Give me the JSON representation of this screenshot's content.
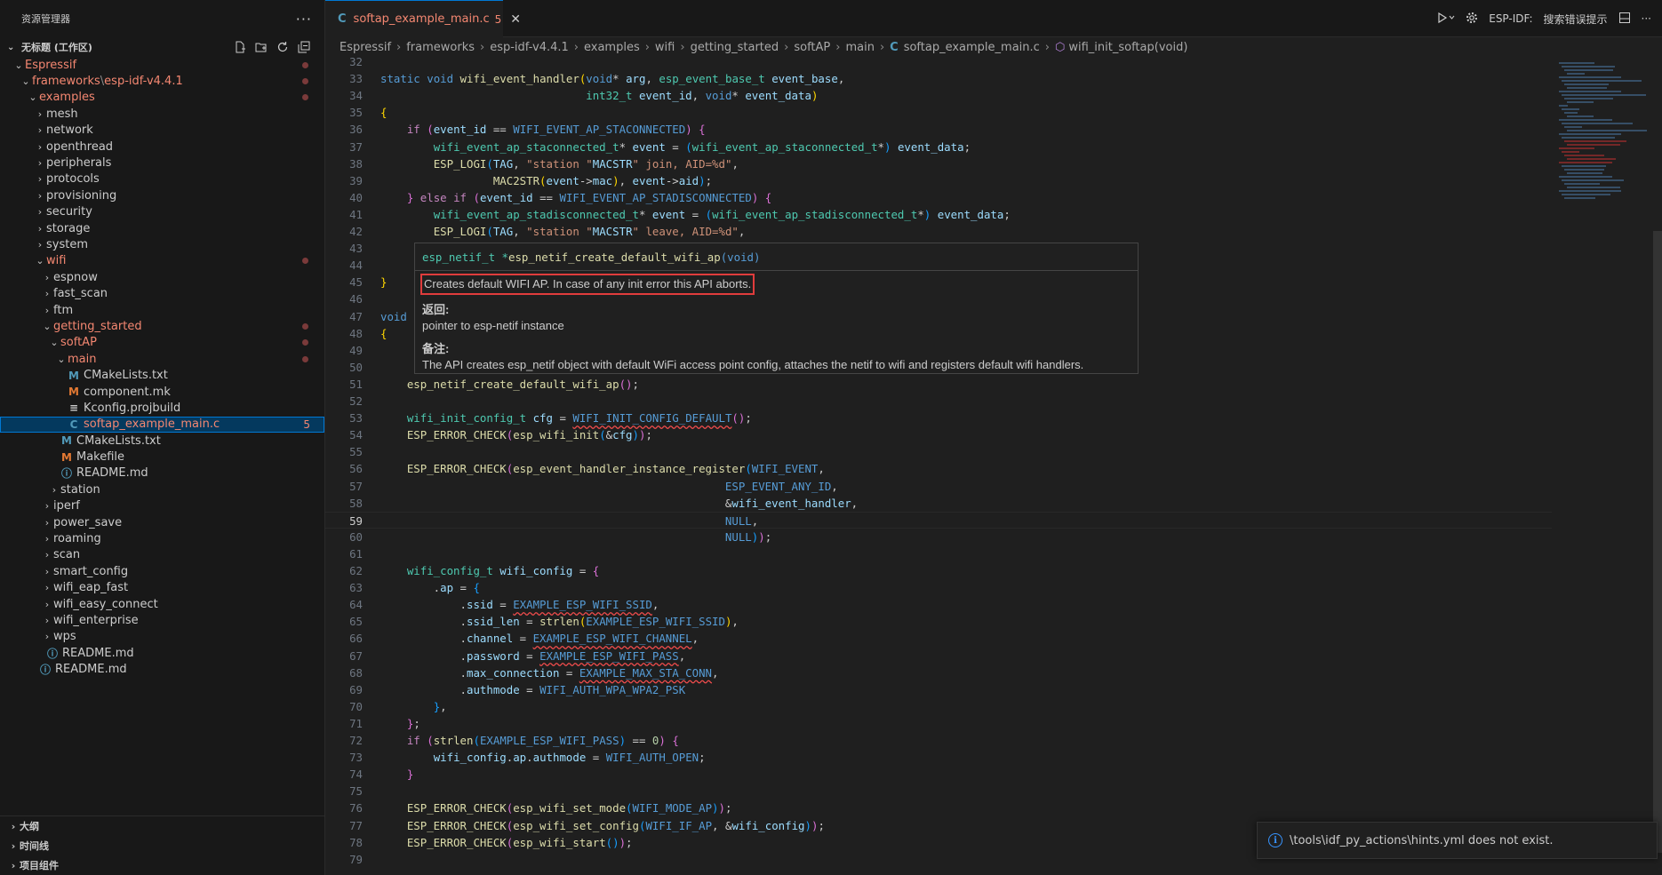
{
  "sidebar": {
    "title": "资源管理器",
    "more": "···",
    "workspace": "无标题 (工作区)",
    "tree": [
      {
        "label": "Espressif",
        "depth": 1,
        "chev": "down",
        "cls": "err",
        "dot": true
      },
      {
        "label": "frameworks",
        "label2": "esp-idf-v4.4.1",
        "depth": 2,
        "chev": "down",
        "cls": "err",
        "dot": true
      },
      {
        "label": "examples",
        "depth": 3,
        "chev": "down",
        "cls": "err",
        "dot": true
      },
      {
        "label": "mesh",
        "depth": 4,
        "chev": "right"
      },
      {
        "label": "network",
        "depth": 4,
        "chev": "right"
      },
      {
        "label": "openthread",
        "depth": 4,
        "chev": "right"
      },
      {
        "label": "peripherals",
        "depth": 4,
        "chev": "right"
      },
      {
        "label": "protocols",
        "depth": 4,
        "chev": "right"
      },
      {
        "label": "provisioning",
        "depth": 4,
        "chev": "right"
      },
      {
        "label": "security",
        "depth": 4,
        "chev": "right"
      },
      {
        "label": "storage",
        "depth": 4,
        "chev": "right"
      },
      {
        "label": "system",
        "depth": 4,
        "chev": "right"
      },
      {
        "label": "wifi",
        "depth": 4,
        "chev": "down",
        "cls": "err",
        "dot": true
      },
      {
        "label": "espnow",
        "depth": 5,
        "chev": "right"
      },
      {
        "label": "fast_scan",
        "depth": 5,
        "chev": "right"
      },
      {
        "label": "ftm",
        "depth": 5,
        "chev": "right"
      },
      {
        "label": "getting_started",
        "depth": 5,
        "chev": "down",
        "cls": "err",
        "dot": true
      },
      {
        "label": "softAP",
        "depth": 6,
        "chev": "down",
        "cls": "err",
        "dot": true
      },
      {
        "label": "main",
        "depth": 7,
        "chev": "down",
        "cls": "err",
        "dot": true
      },
      {
        "label": "CMakeLists.txt",
        "depth": 8,
        "icon": "M",
        "iconColor": "#519aba"
      },
      {
        "label": "component.mk",
        "depth": 8,
        "icon": "M",
        "iconColor": "#e37933"
      },
      {
        "label": "Kconfig.projbuild",
        "depth": 8,
        "icon": "≡",
        "iconColor": "#cccccc"
      },
      {
        "label": "softap_example_main.c",
        "depth": 8,
        "icon": "C",
        "iconColor": "#519aba",
        "cls": "err sel",
        "badge": "5"
      },
      {
        "label": "CMakeLists.txt",
        "depth": 7,
        "icon": "M",
        "iconColor": "#519aba"
      },
      {
        "label": "Makefile",
        "depth": 7,
        "icon": "M",
        "iconColor": "#e37933"
      },
      {
        "label": "README.md",
        "depth": 7,
        "icon": "ⓘ",
        "iconColor": "#519aba"
      },
      {
        "label": "station",
        "depth": 6,
        "chev": "right"
      },
      {
        "label": "iperf",
        "depth": 5,
        "chev": "right"
      },
      {
        "label": "power_save",
        "depth": 5,
        "chev": "right"
      },
      {
        "label": "roaming",
        "depth": 5,
        "chev": "right"
      },
      {
        "label": "scan",
        "depth": 5,
        "chev": "right"
      },
      {
        "label": "smart_config",
        "depth": 5,
        "chev": "right"
      },
      {
        "label": "wifi_eap_fast",
        "depth": 5,
        "chev": "right"
      },
      {
        "label": "wifi_easy_connect",
        "depth": 5,
        "chev": "right"
      },
      {
        "label": "wifi_enterprise",
        "depth": 5,
        "chev": "right"
      },
      {
        "label": "wps",
        "depth": 5,
        "chev": "right"
      },
      {
        "label": "README.md",
        "depth": 5,
        "icon": "ⓘ",
        "iconColor": "#519aba"
      },
      {
        "label": "README.md",
        "depth": 4,
        "icon": "ⓘ",
        "iconColor": "#519aba"
      }
    ],
    "bottom": [
      "大纲",
      "时间线",
      "项目组件"
    ]
  },
  "tab": {
    "label": "softap_example_main.c",
    "count": "5",
    "close": "✕"
  },
  "toolbar": {
    "idf_label": "ESP-IDF:",
    "hint_label": "搜索错误提示"
  },
  "breadcrumbs": [
    "Espressif",
    "frameworks",
    "esp-idf-v4.4.1",
    "examples",
    "wifi",
    "getting_started",
    "softAP",
    "main",
    "softap_example_main.c",
    "wifi_init_softap(void)"
  ],
  "editor": {
    "current_line": 59,
    "lines": [
      {
        "n": 32,
        "t": ""
      },
      {
        "n": 33,
        "t": "[kw|static] [kw|void] [fn|wifi_event_handler][p1|(][kw|void][pl|*] [va|arg], [ty|esp_event_base_t] [va|event_base],"
      },
      {
        "n": 34,
        "t": "                               [ty|int32_t] [va|event_id], [kw|void][pl|*] [va|event_data][p1|)]"
      },
      {
        "n": 35,
        "t": "[p1|{]"
      },
      {
        "n": 36,
        "t": "    [ctl|if] [p2|(][va|event_id] == [mac|WIFI_EVENT_AP_STACONNECTED][p2|)] [p2|{]"
      },
      {
        "n": 37,
        "t": "        [ty|wifi_event_ap_staconnected_t][pl|*] [va|event] = [p3|(][ty|wifi_event_ap_staconnected_t][pl|*][p3|)] [va|event_data];"
      },
      {
        "n": 38,
        "t": "        [fn|ESP_LOGI][p3|(][va|TAG], [st|\"station \"][va|MACSTR][st|\" join, AID=%d\"],"
      },
      {
        "n": 39,
        "t": "                 [fn|MAC2STR][p1|(][va|event][pl|->][va|mac][p1|)], [va|event][pl|->][va|aid][p3|)];"
      },
      {
        "n": 40,
        "t": "    [p2|}] [ctl|else] [ctl|if] [p2|(][va|event_id] == [mac|WIFI_EVENT_AP_STADISCONNECTED][p2|)] [p2|{]"
      },
      {
        "n": 41,
        "t": "        [ty|wifi_event_ap_stadisconnected_t][pl|*] [va|event] = [p3|(][ty|wifi_event_ap_stadisconnected_t][pl|*][p3|)] [va|event_data];"
      },
      {
        "n": 42,
        "t": "        [fn|ESP_LOGI][p3|(][va|TAG], [st|\"station \"][va|MACSTR][st|\" leave, AID=%d\"],"
      },
      {
        "n": 43,
        "t": ""
      },
      {
        "n": 44,
        "t": ""
      },
      {
        "n": 45,
        "t": "[p1|}]"
      },
      {
        "n": 46,
        "t": ""
      },
      {
        "n": 47,
        "t": "[kw|void]"
      },
      {
        "n": 48,
        "t": "[p1|{]"
      },
      {
        "n": 49,
        "t": ""
      },
      {
        "n": 50,
        "t": ""
      },
      {
        "n": 51,
        "t": "    [fn|esp_netif_create_default_wifi_ap][p2|()];"
      },
      {
        "n": 52,
        "t": ""
      },
      {
        "n": 53,
        "t": "    [ty|wifi_init_config_t] [va|cfg] = [mac|~WIFI_INIT_CONFIG_DEFAULT][p2|()];"
      },
      {
        "n": 54,
        "t": "    [fn|ESP_ERROR_CHECK][p2|(][fn|esp_wifi_init][p3|(][pl|&][va|cfg][p3|)][p2|)];"
      },
      {
        "n": 55,
        "t": ""
      },
      {
        "n": 56,
        "t": "    [fn|ESP_ERROR_CHECK][p2|(][fn|esp_event_handler_instance_register][p3|(][mac|WIFI_EVENT],"
      },
      {
        "n": 57,
        "t": "                                                    [mac|ESP_EVENT_ANY_ID],"
      },
      {
        "n": 58,
        "t": "                                                    [pl|&][va|wifi_event_handler],"
      },
      {
        "n": 59,
        "t": "                                                    [mac|NULL],"
      },
      {
        "n": 60,
        "t": "                                                    [mac|NULL][p3|)][p2|)];"
      },
      {
        "n": 61,
        "t": ""
      },
      {
        "n": 62,
        "t": "    [ty|wifi_config_t] [va|wifi_config] = [p2|{]"
      },
      {
        "n": 63,
        "t": "        .[va|ap] = [p3|{]"
      },
      {
        "n": 64,
        "t": "            .[va|ssid] = [mac|~EXAMPLE_ESP_WIFI_SSID],"
      },
      {
        "n": 65,
        "t": "            .[va|ssid_len] = [fn|strlen][p1|(][mac|EXAMPLE_ESP_WIFI_SSID][p1|)],"
      },
      {
        "n": 66,
        "t": "            .[va|channel] = [mac|~EXAMPLE_ESP_WIFI_CHANNEL],"
      },
      {
        "n": 67,
        "t": "            .[va|password] = [mac|~EXAMPLE_ESP_WIFI_PASS],"
      },
      {
        "n": 68,
        "t": "            .[va|max_connection] = [mac|~EXAMPLE_MAX_STA_CONN],"
      },
      {
        "n": 69,
        "t": "            .[va|authmode] = [mac|WIFI_AUTH_WPA_WPA2_PSK]"
      },
      {
        "n": 70,
        "t": "        [p3|}],"
      },
      {
        "n": 71,
        "t": "    [p2|}];"
      },
      {
        "n": 72,
        "t": "    [ctl|if] [p2|(][fn|strlen][p3|(][mac|EXAMPLE_ESP_WIFI_PASS][p3|)] == [nu|0][p2|)] [p2|{]"
      },
      {
        "n": 73,
        "t": "        [va|wifi_config].[va|ap].[va|authmode] = [mac|WIFI_AUTH_OPEN];"
      },
      {
        "n": 74,
        "t": "    [p2|}]"
      },
      {
        "n": 75,
        "t": ""
      },
      {
        "n": 76,
        "t": "    [fn|ESP_ERROR_CHECK][p2|(][fn|esp_wifi_set_mode][p3|(][mac|WIFI_MODE_AP][p3|)][p2|)];"
      },
      {
        "n": 77,
        "t": "    [fn|ESP_ERROR_CHECK][p2|(][fn|esp_wifi_set_config][p3|(][mac|WIFI_IF_AP], [pl|&][va|wifi_config][p3|)][p2|)];"
      },
      {
        "n": 78,
        "t": "    [fn|ESP_ERROR_CHECK][p2|(][fn|esp_wifi_start][p3|()][p2|)];"
      },
      {
        "n": 79,
        "t": ""
      }
    ]
  },
  "hover": {
    "signature_type": "esp_netif_t *",
    "signature_fn": "esp_netif_create_default_wifi_ap",
    "signature_args": "(void)",
    "description": "Creates default WIFI AP. In case of any init error this API aborts.",
    "returns_heading": "返回:",
    "returns_text": "pointer to esp-netif instance",
    "notes_heading": "备注:",
    "notes_text": "The API creates esp_netif object with default WiFi access point config, attaches the netif to wifi and registers default wifi handlers."
  },
  "notification": {
    "text": "\\tools\\idf_py_actions\\hints.yml does not exist."
  },
  "colors": {
    "accent": "#0078d4",
    "error": "#f48771",
    "highlight_box": "#e03c3c"
  }
}
